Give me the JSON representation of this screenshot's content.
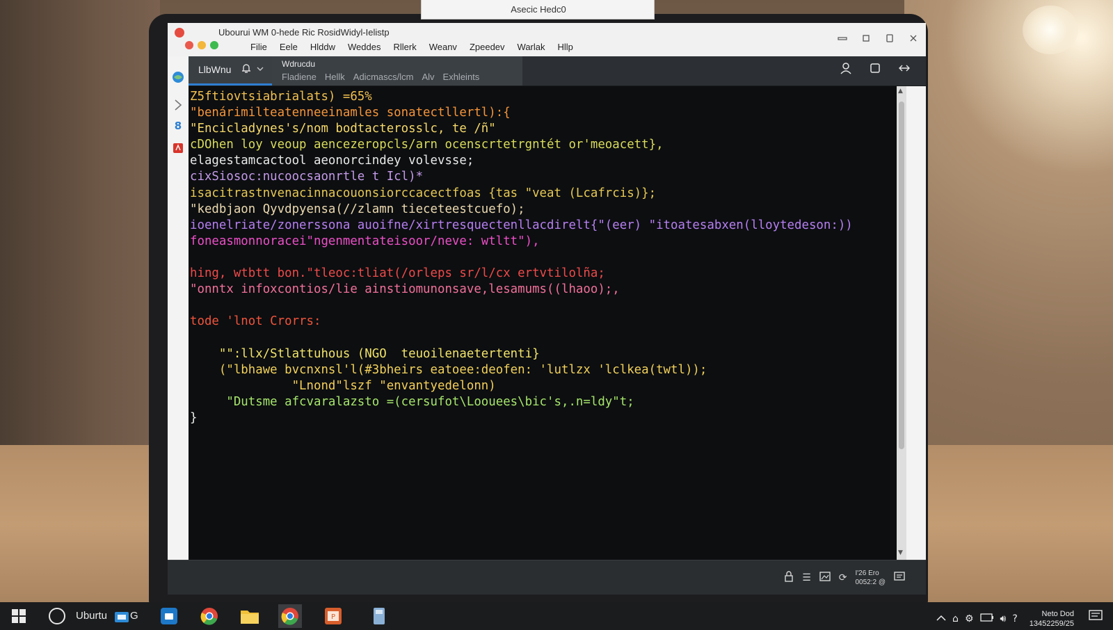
{
  "top_popup": {
    "text": "Asecic Hedc0"
  },
  "window": {
    "title": "Ubourui WM 0-hede Ric RosidWidyl-Ielistp",
    "menu": [
      "Filie",
      "Eele",
      "Hlddw",
      "Weddes",
      "Rllerk",
      "Weanv",
      "Zpeedev",
      "Warlak",
      "Hllp"
    ]
  },
  "tabs": {
    "active_label": "LlbWnu",
    "second_title": "Wdrucdu",
    "subtabs": [
      "Fladiene",
      "Hellk",
      "Adicmascs/lcm",
      "Alv",
      "Exhleints"
    ]
  },
  "code_lines": [
    {
      "text": "Z5ftiovtsiabrialats) =65%",
      "color": "#f2c14e"
    },
    {
      "text": "\"benárimilteatenneeinamles sonatectllertl):{",
      "color": "#f5943a"
    },
    {
      "text": "\"Encicladynes's/nom bodtacterosslc, te /ñ\"",
      "color": "#f6d96b"
    },
    {
      "text": "cDOhen loy veoup aencezeropcls/arn ocenscrtetrgntét or'meoacett},",
      "color": "#d9dc5a"
    },
    {
      "text": "elagestamcactool aeonorcindey volevsse;",
      "color": "#e9e9e9"
    },
    {
      "text": "cixSiosoc:nucoocsaonrtle t Icl)*",
      "color": "#c49ae8"
    },
    {
      "text": "isacitrastnvenacinnacouonsiorccacectfoas {tas \"veat (Lcafrcis)};",
      "color": "#e7c954"
    },
    {
      "text": "\"kedbjaon Qyvdpyensa(//zlamn tieceteestcuefo);",
      "color": "#ecd9b0"
    },
    {
      "text": "ioenelriate/zonerssona auoifne/xirtresquectenllacdirelt{\"(eer) \"itoatesabxen(lloytedeson:))",
      "color": "#b77ff2"
    },
    {
      "text": "foneasmonnoracei\"ngenmentateisoor/neve: wtltt\"),",
      "color": "#ec4fc7"
    },
    {
      "text": "",
      "color": "#e9e9e9"
    },
    {
      "text": "hing, wtbtt bon.\"tleoc:tliat(/orleps sr/l/cx ertvtilolña;",
      "color": "#f04a4a"
    },
    {
      "text": "\"onntx infoxcontios/lie ainstiomunonsave,lesamums((lhaoo);,",
      "color": "#f2709a"
    },
    {
      "text": "",
      "color": "#e9e9e9"
    },
    {
      "text": "tode 'lnot Crorrs:",
      "color": "#f0543c"
    },
    {
      "text": "",
      "color": "#e9e9e9"
    },
    {
      "text": "    \"\":llx/Stlattuhous (NGO  teuoilenaetertenti}",
      "color": "#f3e46a"
    },
    {
      "text": "    (\"lbhawe bvcnxnsl'l(#3bheirs eatoee:deofen: 'lutlzx 'lclkea(twtl));",
      "color": "#f2d15a"
    },
    {
      "text": "              \"Lnond\"lszf \"envantyedelonn)",
      "color": "#f6cf58"
    },
    {
      "text": "     \"Dutsme afcvaralazsto =(cersufot\\Loouees\\bic's,.n=ldy\"t;",
      "color": "#a6e56b"
    },
    {
      "text": "}",
      "color": "#ececec"
    }
  ],
  "statusbar": {
    "clock_line1": "I'26 Ero",
    "clock_line2": "0052:2 @"
  },
  "taskbar": {
    "search_label": "Uburtu",
    "search_suffix": "G",
    "clock_line1": "Neto Dod",
    "clock_line2": "13452259/25"
  }
}
